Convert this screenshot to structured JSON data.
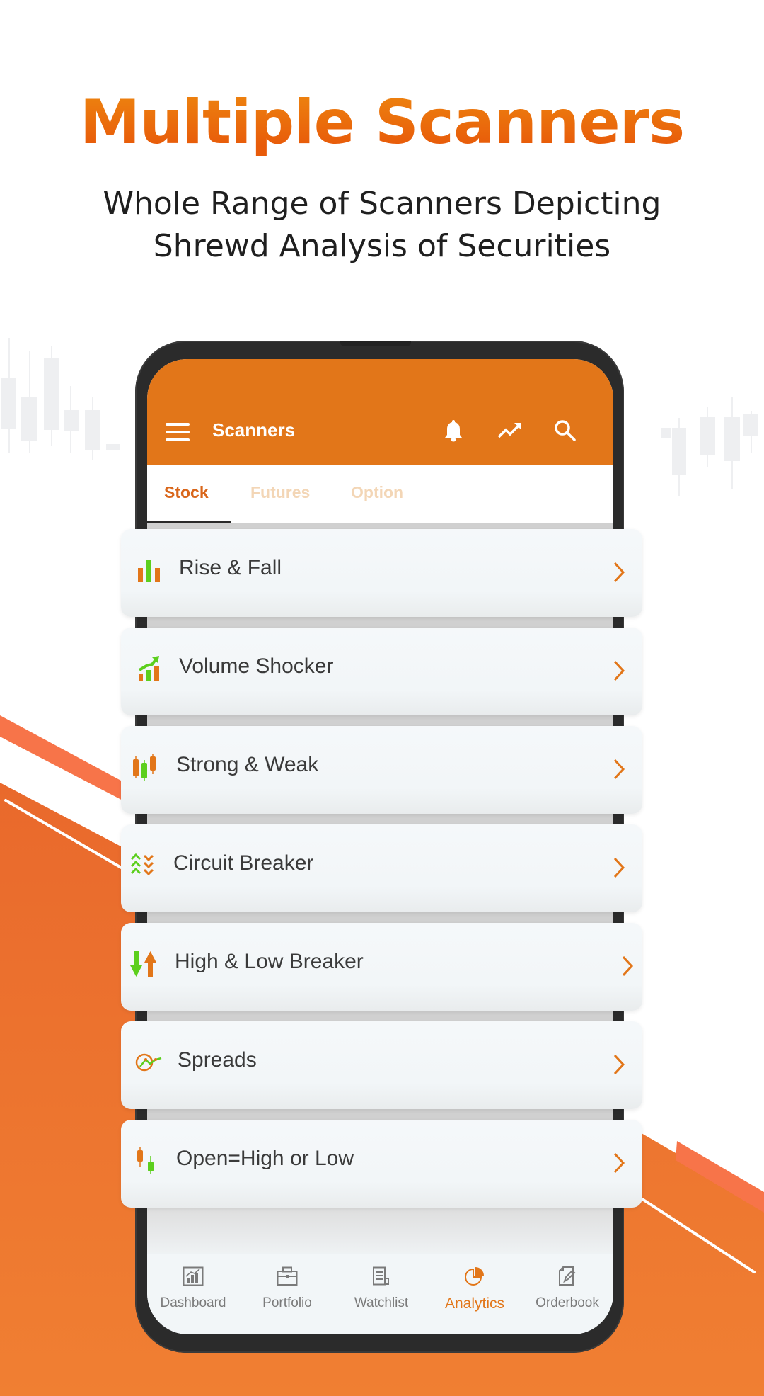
{
  "hero": {
    "title": "Multiple Scanners",
    "subtitle_line1": "Whole Range of Scanners Depicting",
    "subtitle_line2": "Shrewd Analysis of Securities"
  },
  "colors": {
    "accent": "#e27619",
    "title_gradient_top": "#ee8a10",
    "title_gradient_bottom": "#e85b0a",
    "up_green": "#5ccf1d",
    "background_orange": "#ec7030",
    "stripe_orange": "#f77449",
    "text_dark": "#3a3a3a"
  },
  "appbar": {
    "title": "Scanners",
    "icons": [
      "menu-icon",
      "bell-icon",
      "trending-up-icon",
      "search-icon"
    ]
  },
  "tabs": [
    {
      "label": "Stock",
      "active": true
    },
    {
      "label": "Futures",
      "active": false
    },
    {
      "label": "Option",
      "active": false
    }
  ],
  "scanners": [
    {
      "label": "Rise & Fall",
      "icon": "bar-chart-icon"
    },
    {
      "label": "Volume Shocker",
      "icon": "volume-growth-icon"
    },
    {
      "label": "Strong & Weak",
      "icon": "candlestick-icon"
    },
    {
      "label": "Circuit Breaker",
      "icon": "up-down-chevrons-icon"
    },
    {
      "label": "High & Low Breaker",
      "icon": "down-up-arrows-icon"
    },
    {
      "label": "Spreads",
      "icon": "spread-gauge-icon"
    },
    {
      "label": "Open=High or Low",
      "icon": "open-high-low-candles-icon"
    }
  ],
  "bottom_nav": [
    {
      "label": "Dashboard",
      "icon": "dashboard-chart-icon",
      "active": false
    },
    {
      "label": "Portfolio",
      "icon": "briefcase-icon",
      "active": false
    },
    {
      "label": "Watchlist",
      "icon": "list-document-icon",
      "active": false
    },
    {
      "label": "Analytics",
      "icon": "pie-chart-icon",
      "active": true
    },
    {
      "label": "Orderbook",
      "icon": "edit-document-icon",
      "active": false
    }
  ]
}
